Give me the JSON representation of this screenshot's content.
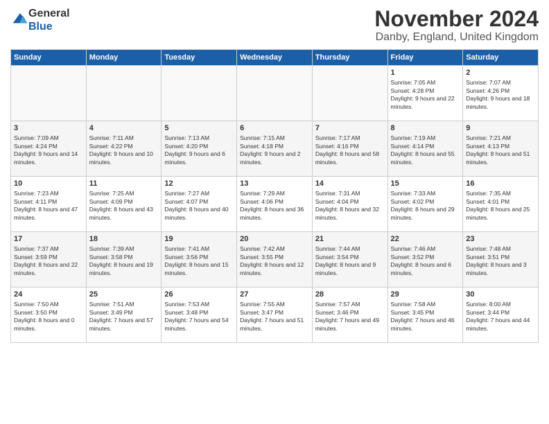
{
  "logo": {
    "general": "General",
    "blue": "Blue"
  },
  "title": "November 2024",
  "location": "Danby, England, United Kingdom",
  "headers": [
    "Sunday",
    "Monday",
    "Tuesday",
    "Wednesday",
    "Thursday",
    "Friday",
    "Saturday"
  ],
  "weeks": [
    [
      {
        "day": "",
        "info": ""
      },
      {
        "day": "",
        "info": ""
      },
      {
        "day": "",
        "info": ""
      },
      {
        "day": "",
        "info": ""
      },
      {
        "day": "",
        "info": ""
      },
      {
        "day": "1",
        "info": "Sunrise: 7:05 AM\nSunset: 4:28 PM\nDaylight: 9 hours and 22 minutes."
      },
      {
        "day": "2",
        "info": "Sunrise: 7:07 AM\nSunset: 4:26 PM\nDaylight: 9 hours and 18 minutes."
      }
    ],
    [
      {
        "day": "3",
        "info": "Sunrise: 7:09 AM\nSunset: 4:24 PM\nDaylight: 9 hours and 14 minutes."
      },
      {
        "day": "4",
        "info": "Sunrise: 7:11 AM\nSunset: 4:22 PM\nDaylight: 9 hours and 10 minutes."
      },
      {
        "day": "5",
        "info": "Sunrise: 7:13 AM\nSunset: 4:20 PM\nDaylight: 9 hours and 6 minutes."
      },
      {
        "day": "6",
        "info": "Sunrise: 7:15 AM\nSunset: 4:18 PM\nDaylight: 9 hours and 2 minutes."
      },
      {
        "day": "7",
        "info": "Sunrise: 7:17 AM\nSunset: 4:16 PM\nDaylight: 8 hours and 58 minutes."
      },
      {
        "day": "8",
        "info": "Sunrise: 7:19 AM\nSunset: 4:14 PM\nDaylight: 8 hours and 55 minutes."
      },
      {
        "day": "9",
        "info": "Sunrise: 7:21 AM\nSunset: 4:13 PM\nDaylight: 8 hours and 51 minutes."
      }
    ],
    [
      {
        "day": "10",
        "info": "Sunrise: 7:23 AM\nSunset: 4:11 PM\nDaylight: 8 hours and 47 minutes."
      },
      {
        "day": "11",
        "info": "Sunrise: 7:25 AM\nSunset: 4:09 PM\nDaylight: 8 hours and 43 minutes."
      },
      {
        "day": "12",
        "info": "Sunrise: 7:27 AM\nSunset: 4:07 PM\nDaylight: 8 hours and 40 minutes."
      },
      {
        "day": "13",
        "info": "Sunrise: 7:29 AM\nSunset: 4:06 PM\nDaylight: 8 hours and 36 minutes."
      },
      {
        "day": "14",
        "info": "Sunrise: 7:31 AM\nSunset: 4:04 PM\nDaylight: 8 hours and 32 minutes."
      },
      {
        "day": "15",
        "info": "Sunrise: 7:33 AM\nSunset: 4:02 PM\nDaylight: 8 hours and 29 minutes."
      },
      {
        "day": "16",
        "info": "Sunrise: 7:35 AM\nSunset: 4:01 PM\nDaylight: 8 hours and 25 minutes."
      }
    ],
    [
      {
        "day": "17",
        "info": "Sunrise: 7:37 AM\nSunset: 3:59 PM\nDaylight: 8 hours and 22 minutes."
      },
      {
        "day": "18",
        "info": "Sunrise: 7:39 AM\nSunset: 3:58 PM\nDaylight: 8 hours and 19 minutes."
      },
      {
        "day": "19",
        "info": "Sunrise: 7:41 AM\nSunset: 3:56 PM\nDaylight: 8 hours and 15 minutes."
      },
      {
        "day": "20",
        "info": "Sunrise: 7:42 AM\nSunset: 3:55 PM\nDaylight: 8 hours and 12 minutes."
      },
      {
        "day": "21",
        "info": "Sunrise: 7:44 AM\nSunset: 3:54 PM\nDaylight: 8 hours and 9 minutes."
      },
      {
        "day": "22",
        "info": "Sunrise: 7:46 AM\nSunset: 3:52 PM\nDaylight: 8 hours and 6 minutes."
      },
      {
        "day": "23",
        "info": "Sunrise: 7:48 AM\nSunset: 3:51 PM\nDaylight: 8 hours and 3 minutes."
      }
    ],
    [
      {
        "day": "24",
        "info": "Sunrise: 7:50 AM\nSunset: 3:50 PM\nDaylight: 8 hours and 0 minutes."
      },
      {
        "day": "25",
        "info": "Sunrise: 7:51 AM\nSunset: 3:49 PM\nDaylight: 7 hours and 57 minutes."
      },
      {
        "day": "26",
        "info": "Sunrise: 7:53 AM\nSunset: 3:48 PM\nDaylight: 7 hours and 54 minutes."
      },
      {
        "day": "27",
        "info": "Sunrise: 7:55 AM\nSunset: 3:47 PM\nDaylight: 7 hours and 51 minutes."
      },
      {
        "day": "28",
        "info": "Sunrise: 7:57 AM\nSunset: 3:46 PM\nDaylight: 7 hours and 49 minutes."
      },
      {
        "day": "29",
        "info": "Sunrise: 7:58 AM\nSunset: 3:45 PM\nDaylight: 7 hours and 46 minutes."
      },
      {
        "day": "30",
        "info": "Sunrise: 8:00 AM\nSunset: 3:44 PM\nDaylight: 7 hours and 44 minutes."
      }
    ]
  ]
}
